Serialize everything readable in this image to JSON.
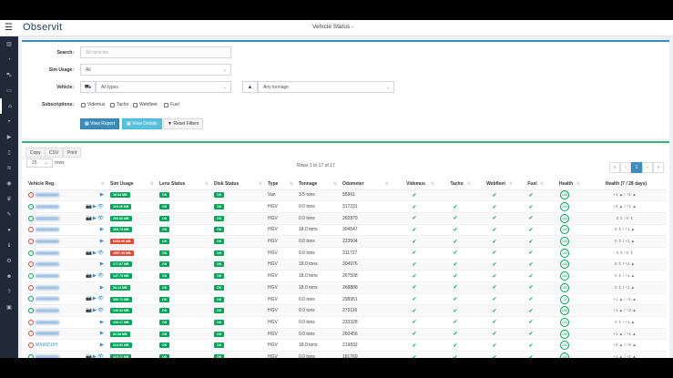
{
  "header": {
    "logo": "Observit",
    "title": "Vehicle Status -"
  },
  "sidebar": {
    "icons": [
      "chart-icon",
      "dashboard-icon",
      "car-icon",
      "id-card-icon",
      "garage-icon",
      "speedometer-icon",
      "play-icon",
      "tablet-icon",
      "layers-icon",
      "eye-icon",
      "trophy-icon",
      "wrench-icon",
      "user-icon",
      "info-icon",
      "gear-icon",
      "user-cog-icon",
      "help-icon",
      "image-icon"
    ],
    "active": 4
  },
  "filters": {
    "search_label": "Search:",
    "search_placeholder": "All vehicles",
    "sim_label": "Sim Usage:",
    "sim_value": "All",
    "vehicle_label": "Vehicle:",
    "vehicle_type": "All types",
    "tonnage": "Any tonnage",
    "subs_label": "Subscriptions:",
    "subs": [
      "Videmus",
      "Tacho",
      "Webfleet",
      "Fuel"
    ],
    "view_report": "View Report",
    "view_details": "View Details",
    "reset": "Reset Filters"
  },
  "table_tools": {
    "copy": "Copy",
    "csv": "CSV",
    "print": "Print",
    "page_size": "25",
    "rows_label": "rows",
    "info": "Rows 1 to 17 of 17",
    "pages": [
      "«",
      "‹",
      "1",
      "›",
      "»"
    ]
  },
  "columns": [
    "Vehicle Reg.",
    "Sim Usage",
    "Lens Status",
    "Disk Status",
    "Type",
    "Tonnage",
    "Odometer",
    "Videmus",
    "Tacho",
    "Webfleet",
    "Fuel",
    "Health",
    "Health (7 / 28 days)"
  ],
  "colors": {
    "ok": "#00a65a",
    "alert": "#dd4b39",
    "primary": "#3c8dbc"
  },
  "rows": [
    {
      "power": "red",
      "reg": "",
      "icons": "▶",
      "sim": "28.94 MB",
      "sim_alert": false,
      "lens": "OK",
      "disk": "OK",
      "type": "Van",
      "tonnage": "3.5 tons",
      "odometer": "55961",
      "videmus": "✔",
      "tacho": "",
      "webfleet": "✔",
      "fuel": "✔",
      "health": "100",
      "h7": "+1 ▲ / +1 ▲"
    },
    {
      "power": "green",
      "reg": "",
      "icons": "📷▶👁",
      "sim": "119.45 MB",
      "sim_alert": false,
      "lens": "OK",
      "disk": "OK",
      "type": "HGV",
      "tonnage": "0.0 tons",
      "odometer": "317231",
      "videmus": "✔",
      "tacho": "✔",
      "webfleet": "✔",
      "fuel": "✔",
      "health": "100",
      "h7": "+2 ▲ / +1 ▲"
    },
    {
      "power": "green",
      "reg": "",
      "icons": "📷▶👁",
      "sim": "293.60 MB",
      "sim_alert": false,
      "lens": "OK",
      "disk": "OK",
      "type": "HGV",
      "tonnage": "0.0 tons",
      "odometer": "262879",
      "videmus": "✔",
      "tacho": "✔",
      "webfleet": "✔",
      "fuel": "✔",
      "health": "100",
      "h7": "0 ⇕ / 0 ⇕"
    },
    {
      "power": "red",
      "reg": "",
      "icons": "▶",
      "sim": "368.74 MB",
      "sim_alert": false,
      "lens": "OK",
      "disk": "OK",
      "type": "HGV",
      "tonnage": "18.0 tons",
      "odometer": "304547",
      "videmus": "✔",
      "tacho": "✔",
      "webfleet": "✔",
      "fuel": "✔",
      "health": "100",
      "h7": "0 ⇕ / +1 ▲"
    },
    {
      "power": "red",
      "reg": "",
      "icons": "▶",
      "sim": "6265.96 MB",
      "sim_alert": true,
      "lens": "OK",
      "disk": "OK",
      "type": "HGV",
      "tonnage": "0.0 tons",
      "odometer": "223504",
      "videmus": "✔",
      "tacho": "✔",
      "webfleet": "✔",
      "fuel": "✔",
      "health": "100",
      "h7": "0 ⇕ / +1 ▲"
    },
    {
      "power": "green",
      "reg": "",
      "icons": "📷▶👁",
      "sim": "1997.49 MB",
      "sim_alert": true,
      "lens": "OK",
      "disk": "OK",
      "type": "HGV",
      "tonnage": "0.0 tons",
      "odometer": "311727",
      "videmus": "✔",
      "tacho": "✔",
      "webfleet": "✔",
      "fuel": "✔",
      "health": "100",
      "h7": "0 ⇕ / 0 ⇕"
    },
    {
      "power": "red",
      "reg": "",
      "icons": "▶",
      "sim": "177.67 MB",
      "sim_alert": false,
      "lens": "OK",
      "disk": "OK",
      "type": "HGV",
      "tonnage": "18.0 tons",
      "odometer": "304976",
      "videmus": "✔",
      "tacho": "✔",
      "webfleet": "✔",
      "fuel": "✔",
      "health": "100",
      "h7": "0 ⇕ / +2 ▲"
    },
    {
      "power": "green",
      "reg": "",
      "icons": "📷▶👁",
      "sim": "147.73 MB",
      "sim_alert": false,
      "lens": "OK",
      "disk": "OK",
      "type": "HGV",
      "tonnage": "18.0 tons",
      "odometer": "267508",
      "videmus": "✔",
      "tacho": "✔",
      "webfleet": "✔",
      "fuel": "✔",
      "health": "100",
      "h7": "0 ⇕ / +1 ▲"
    },
    {
      "power": "red",
      "reg": "",
      "icons": "▶",
      "sim": "93.13 MB",
      "sim_alert": false,
      "lens": "OK",
      "disk": "OK",
      "type": "HGV",
      "tonnage": "18.0 tons",
      "odometer": "268888",
      "videmus": "✔",
      "tacho": "✔",
      "webfleet": "✔",
      "fuel": "✔",
      "health": "100",
      "h7": "0 ⇕ / +1 ▲"
    },
    {
      "power": "green",
      "reg": "",
      "icons": "📷▶👁",
      "sim": "306.71 MB",
      "sim_alert": false,
      "lens": "OK",
      "disk": "OK",
      "type": "HGV",
      "tonnage": "0.0 tons",
      "odometer": "298951",
      "videmus": "✔",
      "tacho": "✔",
      "webfleet": "✔",
      "fuel": "✔",
      "health": "78",
      "h7": "+1 ▲ / +1 ▲"
    },
    {
      "power": "green",
      "reg": "",
      "icons": "📷▶👁",
      "sim": "142.44 MB",
      "sim_alert": false,
      "lens": "OK",
      "disk": "OK",
      "type": "HGV",
      "tonnage": "0.0 tons",
      "odometer": "273116",
      "videmus": "✔",
      "tacho": "✔",
      "webfleet": "✔",
      "fuel": "✔",
      "health": "100",
      "h7": "+1 ▲ / +2 ▲"
    },
    {
      "power": "red",
      "reg": "",
      "icons": "▶",
      "sim": "226.17 MB",
      "sim_alert": false,
      "lens": "OK",
      "disk": "OK",
      "type": "HGV",
      "tonnage": "0.0 tons",
      "odometer": "233328",
      "videmus": "✔",
      "tacho": "✔",
      "webfleet": "✔",
      "fuel": "✔",
      "health": "100",
      "h7": "0 ⇕ / +1 ▲"
    },
    {
      "power": "red",
      "reg": "",
      "icons": "▶",
      "sim": "82.68 MB",
      "sim_alert": false,
      "lens": "OK",
      "disk": "OK",
      "type": "HGV",
      "tonnage": "0.0 tons",
      "odometer": "260456",
      "videmus": "✔",
      "tacho": "✔",
      "webfleet": "✔",
      "fuel": "✔",
      "health": "100",
      "h7": "+1 ▲ / +1 ▲"
    },
    {
      "power": "red",
      "reg": "MX66DUH",
      "icons": "▶",
      "sim": "213.51 MB",
      "sim_alert": false,
      "lens": "OK",
      "disk": "OK",
      "type": "HGV",
      "tonnage": "18.0 tons",
      "odometer": "219832",
      "videmus": "✔",
      "tacho": "✔",
      "webfleet": "✔",
      "fuel": "✔",
      "health": "100",
      "h7": "+2 ▲ / +5 ▲"
    },
    {
      "power": "green",
      "reg": "",
      "icons": "📷▶👁",
      "sim": "119.72 MB",
      "sim_alert": false,
      "lens": "OK",
      "disk": "OK",
      "type": "HGV",
      "tonnage": "0.0 tons",
      "odometer": "181769",
      "videmus": "✔",
      "tacho": "✔",
      "webfleet": "✔",
      "fuel": "✔",
      "health": "100",
      "h7": "+1 ▲ / +1 ▲"
    }
  ]
}
